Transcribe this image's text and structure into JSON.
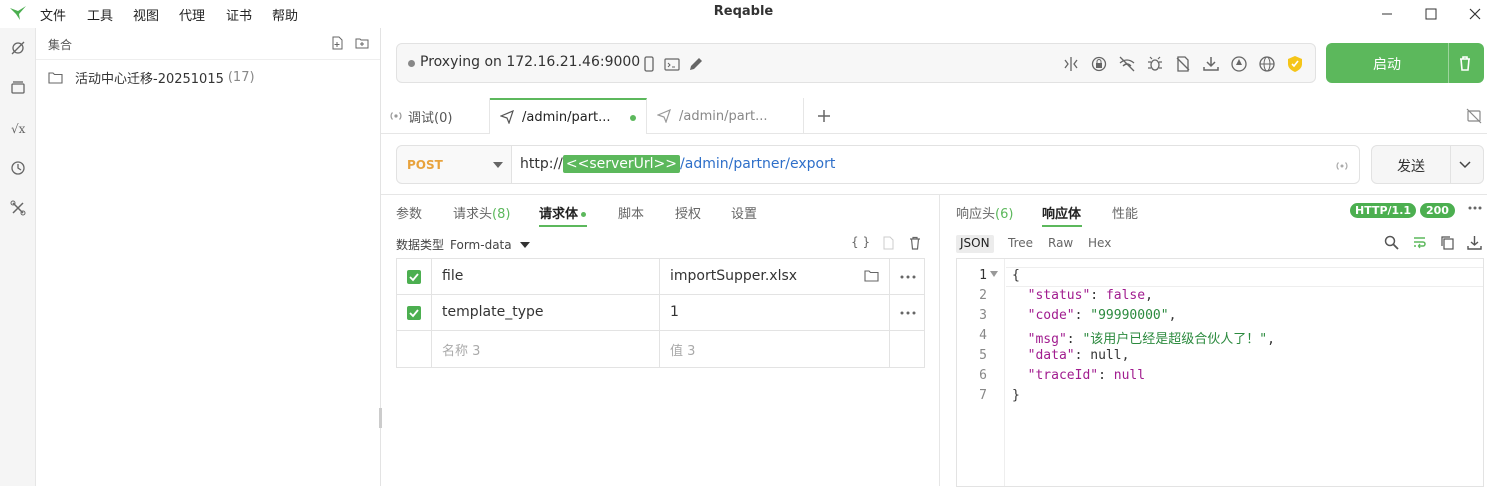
{
  "app": {
    "title": "Reqable",
    "menu": [
      "文件",
      "工具",
      "视图",
      "代理",
      "证书",
      "帮助"
    ],
    "accent": "#5cb85c"
  },
  "collections": {
    "title": "集合",
    "items": [
      {
        "name": "活动中心迁移-20251015",
        "count": "(17)"
      }
    ]
  },
  "proxy": {
    "status": "Proxying on 172.16.21.46:9000",
    "start_label": "启动"
  },
  "tabs": [
    {
      "label": "调试(0)",
      "active": false
    },
    {
      "label": "/admin/part...",
      "active": true
    },
    {
      "label": "/admin/part...",
      "active": false
    }
  ],
  "request": {
    "method": "POST",
    "url_scheme": "http://",
    "url_var": "<<serverUrl>>",
    "url_path": "/admin/partner/export",
    "send_label": "发送",
    "subtabs": [
      {
        "label": "参数"
      },
      {
        "label": "请求头",
        "count": "(8)"
      },
      {
        "label": "请求体",
        "active": true
      },
      {
        "label": "脚本"
      },
      {
        "label": "授权"
      },
      {
        "label": "设置"
      }
    ],
    "data_type_label": "数据类型",
    "data_type_value": "Form-data",
    "rows": [
      {
        "checked": true,
        "name": "file",
        "value": "importSupper.xlsx"
      },
      {
        "checked": true,
        "name": "template_type",
        "value": "1"
      }
    ],
    "placeholder_name": "名称 3",
    "placeholder_value": "值 3"
  },
  "response": {
    "subtabs": [
      {
        "label": "响应头",
        "count": "(6)"
      },
      {
        "label": "响应体",
        "active": true
      },
      {
        "label": "性能"
      }
    ],
    "protocol": "HTTP/1.1",
    "status": "200",
    "formats": [
      "JSON",
      "Tree",
      "Raw",
      "Hex"
    ],
    "line_numbers": [
      "1",
      "2",
      "3",
      "4",
      "5",
      "6",
      "7"
    ],
    "body": {
      "status": "false",
      "code": "\"99990000\"",
      "msg": "\"该用户已经是超级合伙人了！\"",
      "data": "null",
      "traceId": "null"
    }
  }
}
